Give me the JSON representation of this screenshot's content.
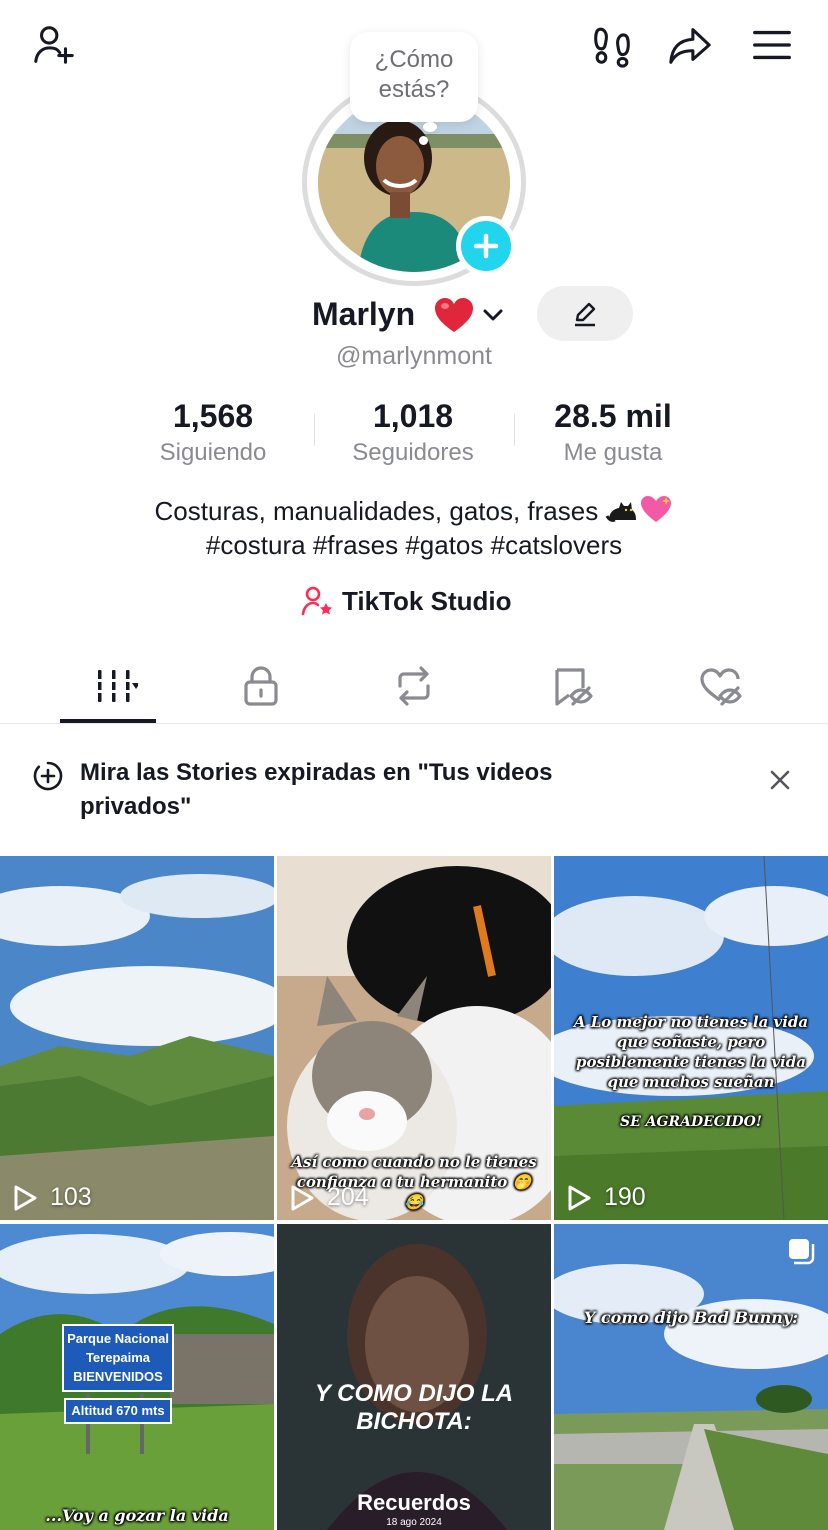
{
  "header": {
    "icons": [
      "add-friend-icon",
      "footprints-icon",
      "share-icon",
      "menu-icon"
    ]
  },
  "status_bubble": {
    "text": "¿Cómo estás?"
  },
  "profile": {
    "name": "Marlyn",
    "handle": "@marlynmont"
  },
  "stats": [
    {
      "value": "1,568",
      "label": "Siguiendo"
    },
    {
      "value": "1,018",
      "label": "Seguidores"
    },
    {
      "value": "28.5 mil",
      "label": "Me gusta"
    }
  ],
  "bio": {
    "line1": "Costuras, manualidades, gatos, frases",
    "line2": "#costura #frases #gatos #catslovers"
  },
  "studio": {
    "label": "TikTok Studio"
  },
  "tabs": [
    {
      "name": "videos",
      "icon": "grid-lines-icon",
      "active": true
    },
    {
      "name": "private",
      "icon": "lock-icon",
      "active": false
    },
    {
      "name": "reposts",
      "icon": "repost-icon",
      "active": false
    },
    {
      "name": "favorites",
      "icon": "bookmark-hidden-icon",
      "active": false
    },
    {
      "name": "liked",
      "icon": "heart-hidden-icon",
      "active": false
    }
  ],
  "notice": {
    "text": "Mira las Stories expiradas en \"Tus videos privados\""
  },
  "videos": [
    {
      "views": "103",
      "caption": ""
    },
    {
      "views": "204",
      "caption": "Así como cuando no le tienes confianza a tu hermanito 🤭😂"
    },
    {
      "views": "190",
      "caption": "A Lo mejor no tienes la vida que soñaste, pero posiblemente tienes la vida que muchos sueñan",
      "caption2": "SE AGRADECIDO!"
    },
    {
      "views": "",
      "caption": "...Voy a gozar la vida",
      "sign_title": "Parque Nacional Terepaima BIENVENIDOS",
      "sign_alt": "Altitud 670 mts"
    },
    {
      "views": "",
      "caption": "Y COMO DIJO LA BICHOTA:",
      "caption2": "Recuerdos",
      "caption3": "18 ago 2024"
    },
    {
      "views": "",
      "caption": "Y como dijo Bad Bunny:"
    }
  ],
  "colors": {
    "accent": "#20d5ec",
    "studio_pink": "#fe2c55",
    "text_secondary": "#8a8b91"
  }
}
